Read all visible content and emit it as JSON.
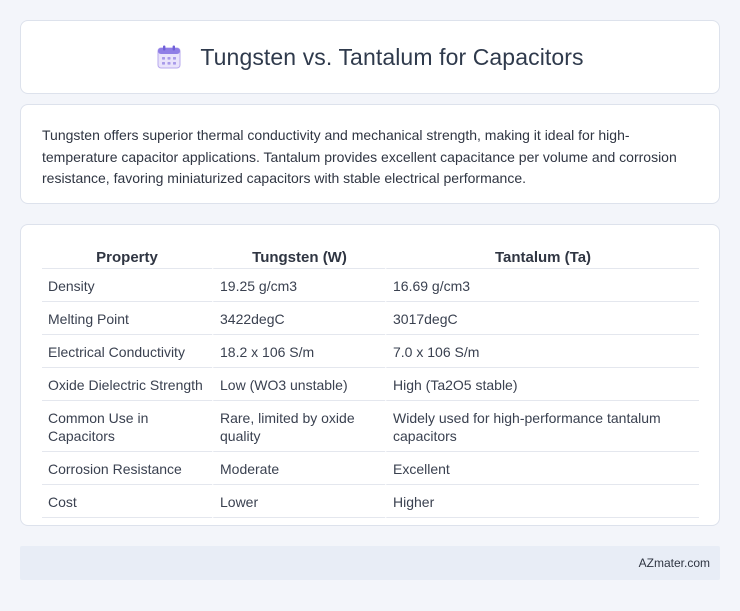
{
  "header": {
    "title": "Tungsten vs. Tantalum for Capacitors",
    "icon": "calendar-icon"
  },
  "intro": {
    "text": "Tungsten offers superior thermal conductivity and mechanical strength, making it ideal for high-temperature capacitor applications. Tantalum provides excellent capacitance per volume and corrosion resistance, favoring miniaturized capacitors with stable electrical performance."
  },
  "table": {
    "headers": [
      "Property",
      "Tungsten (W)",
      "Tantalum (Ta)"
    ],
    "rows": [
      [
        "Density",
        "19.25 g/cm3",
        "16.69 g/cm3"
      ],
      [
        "Melting Point",
        "3422degC",
        "3017degC"
      ],
      [
        "Electrical Conductivity",
        "18.2 x 106 S/m",
        "7.0 x 106 S/m"
      ],
      [
        "Oxide Dielectric Strength",
        "Low (WO3 unstable)",
        "High (Ta2O5 stable)"
      ],
      [
        "Common Use in Capacitors",
        "Rare, limited by oxide quality",
        "Widely used for high-performance tantalum capacitors"
      ],
      [
        "Corrosion Resistance",
        "Moderate",
        "Excellent"
      ],
      [
        "Cost",
        "Lower",
        "Higher"
      ]
    ]
  },
  "footer": {
    "text": "AZmater.com"
  }
}
